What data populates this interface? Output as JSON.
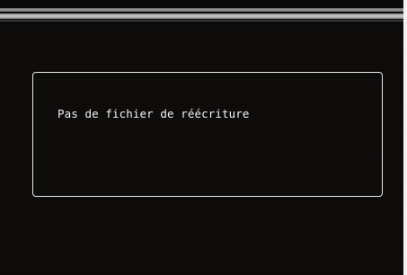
{
  "dialog": {
    "message": "Pas de fichier de réécriture"
  },
  "colors": {
    "screen_background": "#0d0b0a",
    "text": "#f3f3f3",
    "border": "#e9e9e9"
  }
}
